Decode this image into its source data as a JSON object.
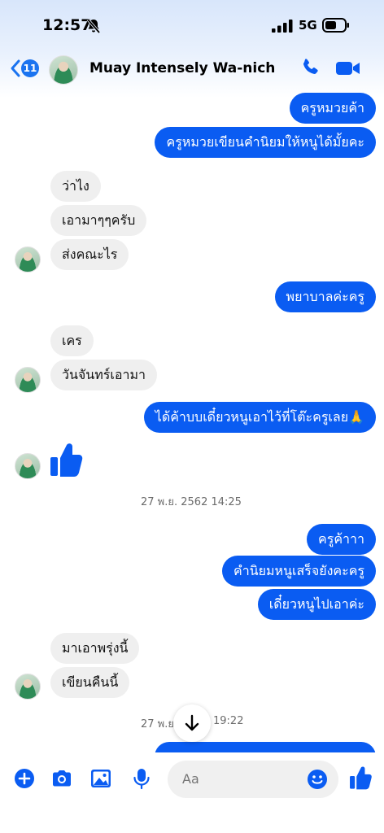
{
  "status_bar": {
    "time": "12:57",
    "network": "5G"
  },
  "header": {
    "back_count": "11",
    "contact_name": "Muay Intensely Wa-nich"
  },
  "messages": [
    {
      "text": "ครูหมวยค้า"
    },
    {
      "text": "ครูหมวยเขียนคำนิยมให้หนูได้มั้ยคะ"
    },
    {
      "text": "ว่าไง"
    },
    {
      "text": "เอามาๆๆครับ"
    },
    {
      "text": "ส่งคณะไร"
    },
    {
      "text": "พยาบาลค่ะครู"
    },
    {
      "text": "เคร"
    },
    {
      "text": "วันจันทร์เอามา"
    },
    {
      "text": "ได้ค้าบบเดี๋ยวหนูเอาไว้ที่โต๊ะครูเลย🙏"
    },
    {
      "text": "ครูค้าาา"
    },
    {
      "text": "คำนิยมหนูเสร็จยังคะครู"
    },
    {
      "text": "เดี๋ยวหนูไปเอาค่ะ"
    },
    {
      "text": "มาเอาพรุ่งนี้"
    },
    {
      "text": "เขียนคืนนี้"
    }
  ],
  "timestamps": [
    {
      "text": "27 พ.ย. 2562 14:25"
    },
    {
      "text_left": "27 พ.ย",
      "text_right": "19:22"
    }
  ],
  "composer": {
    "placeholder": "Aa"
  },
  "colors": {
    "accent": "#0a5cf2",
    "incoming_bubble": "#efefef"
  }
}
